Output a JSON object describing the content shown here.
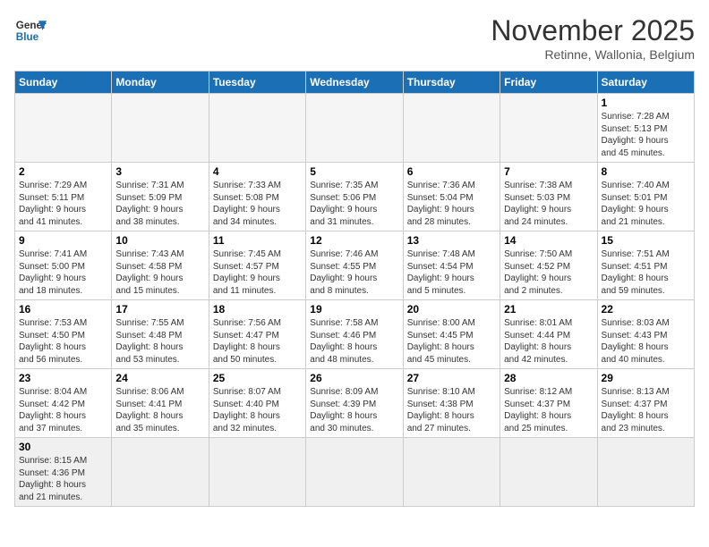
{
  "logo": {
    "line1": "General",
    "line2": "Blue"
  },
  "title": "November 2025",
  "subtitle": "Retinne, Wallonia, Belgium",
  "days_of_week": [
    "Sunday",
    "Monday",
    "Tuesday",
    "Wednesday",
    "Thursday",
    "Friday",
    "Saturday"
  ],
  "weeks": [
    [
      {
        "day": "",
        "info": ""
      },
      {
        "day": "",
        "info": ""
      },
      {
        "day": "",
        "info": ""
      },
      {
        "day": "",
        "info": ""
      },
      {
        "day": "",
        "info": ""
      },
      {
        "day": "",
        "info": ""
      },
      {
        "day": "1",
        "info": "Sunrise: 7:28 AM\nSunset: 5:13 PM\nDaylight: 9 hours\nand 45 minutes."
      }
    ],
    [
      {
        "day": "2",
        "info": "Sunrise: 7:29 AM\nSunset: 5:11 PM\nDaylight: 9 hours\nand 41 minutes."
      },
      {
        "day": "3",
        "info": "Sunrise: 7:31 AM\nSunset: 5:09 PM\nDaylight: 9 hours\nand 38 minutes."
      },
      {
        "day": "4",
        "info": "Sunrise: 7:33 AM\nSunset: 5:08 PM\nDaylight: 9 hours\nand 34 minutes."
      },
      {
        "day": "5",
        "info": "Sunrise: 7:35 AM\nSunset: 5:06 PM\nDaylight: 9 hours\nand 31 minutes."
      },
      {
        "day": "6",
        "info": "Sunrise: 7:36 AM\nSunset: 5:04 PM\nDaylight: 9 hours\nand 28 minutes."
      },
      {
        "day": "7",
        "info": "Sunrise: 7:38 AM\nSunset: 5:03 PM\nDaylight: 9 hours\nand 24 minutes."
      },
      {
        "day": "8",
        "info": "Sunrise: 7:40 AM\nSunset: 5:01 PM\nDaylight: 9 hours\nand 21 minutes."
      }
    ],
    [
      {
        "day": "9",
        "info": "Sunrise: 7:41 AM\nSunset: 5:00 PM\nDaylight: 9 hours\nand 18 minutes."
      },
      {
        "day": "10",
        "info": "Sunrise: 7:43 AM\nSunset: 4:58 PM\nDaylight: 9 hours\nand 15 minutes."
      },
      {
        "day": "11",
        "info": "Sunrise: 7:45 AM\nSunset: 4:57 PM\nDaylight: 9 hours\nand 11 minutes."
      },
      {
        "day": "12",
        "info": "Sunrise: 7:46 AM\nSunset: 4:55 PM\nDaylight: 9 hours\nand 8 minutes."
      },
      {
        "day": "13",
        "info": "Sunrise: 7:48 AM\nSunset: 4:54 PM\nDaylight: 9 hours\nand 5 minutes."
      },
      {
        "day": "14",
        "info": "Sunrise: 7:50 AM\nSunset: 4:52 PM\nDaylight: 9 hours\nand 2 minutes."
      },
      {
        "day": "15",
        "info": "Sunrise: 7:51 AM\nSunset: 4:51 PM\nDaylight: 8 hours\nand 59 minutes."
      }
    ],
    [
      {
        "day": "16",
        "info": "Sunrise: 7:53 AM\nSunset: 4:50 PM\nDaylight: 8 hours\nand 56 minutes."
      },
      {
        "day": "17",
        "info": "Sunrise: 7:55 AM\nSunset: 4:48 PM\nDaylight: 8 hours\nand 53 minutes."
      },
      {
        "day": "18",
        "info": "Sunrise: 7:56 AM\nSunset: 4:47 PM\nDaylight: 8 hours\nand 50 minutes."
      },
      {
        "day": "19",
        "info": "Sunrise: 7:58 AM\nSunset: 4:46 PM\nDaylight: 8 hours\nand 48 minutes."
      },
      {
        "day": "20",
        "info": "Sunrise: 8:00 AM\nSunset: 4:45 PM\nDaylight: 8 hours\nand 45 minutes."
      },
      {
        "day": "21",
        "info": "Sunrise: 8:01 AM\nSunset: 4:44 PM\nDaylight: 8 hours\nand 42 minutes."
      },
      {
        "day": "22",
        "info": "Sunrise: 8:03 AM\nSunset: 4:43 PM\nDaylight: 8 hours\nand 40 minutes."
      }
    ],
    [
      {
        "day": "23",
        "info": "Sunrise: 8:04 AM\nSunset: 4:42 PM\nDaylight: 8 hours\nand 37 minutes."
      },
      {
        "day": "24",
        "info": "Sunrise: 8:06 AM\nSunset: 4:41 PM\nDaylight: 8 hours\nand 35 minutes."
      },
      {
        "day": "25",
        "info": "Sunrise: 8:07 AM\nSunset: 4:40 PM\nDaylight: 8 hours\nand 32 minutes."
      },
      {
        "day": "26",
        "info": "Sunrise: 8:09 AM\nSunset: 4:39 PM\nDaylight: 8 hours\nand 30 minutes."
      },
      {
        "day": "27",
        "info": "Sunrise: 8:10 AM\nSunset: 4:38 PM\nDaylight: 8 hours\nand 27 minutes."
      },
      {
        "day": "28",
        "info": "Sunrise: 8:12 AM\nSunset: 4:37 PM\nDaylight: 8 hours\nand 25 minutes."
      },
      {
        "day": "29",
        "info": "Sunrise: 8:13 AM\nSunset: 4:37 PM\nDaylight: 8 hours\nand 23 minutes."
      }
    ],
    [
      {
        "day": "30",
        "info": "Sunrise: 8:15 AM\nSunset: 4:36 PM\nDaylight: 8 hours\nand 21 minutes."
      },
      {
        "day": "",
        "info": ""
      },
      {
        "day": "",
        "info": ""
      },
      {
        "day": "",
        "info": ""
      },
      {
        "day": "",
        "info": ""
      },
      {
        "day": "",
        "info": ""
      },
      {
        "day": "",
        "info": ""
      }
    ]
  ]
}
